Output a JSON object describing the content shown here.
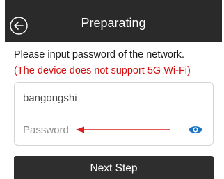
{
  "header": {
    "title": "Preparating",
    "back_icon": "circle-arrow-left-icon",
    "background": "#2a2a2a"
  },
  "main": {
    "instruction": "Please input password of the network.",
    "warning": "(The device does not support 5G Wi-Fi)",
    "warning_color": "#d20f0f"
  },
  "form": {
    "ssid_value": "bangongshi",
    "password_placeholder": "Password",
    "password_value": "",
    "visibility_icon": "eye-icon",
    "visibility_icon_color": "#1a73c8"
  },
  "annotation": {
    "arrow_color": "#d9201b"
  },
  "footer": {
    "next_label": "Next Step"
  }
}
